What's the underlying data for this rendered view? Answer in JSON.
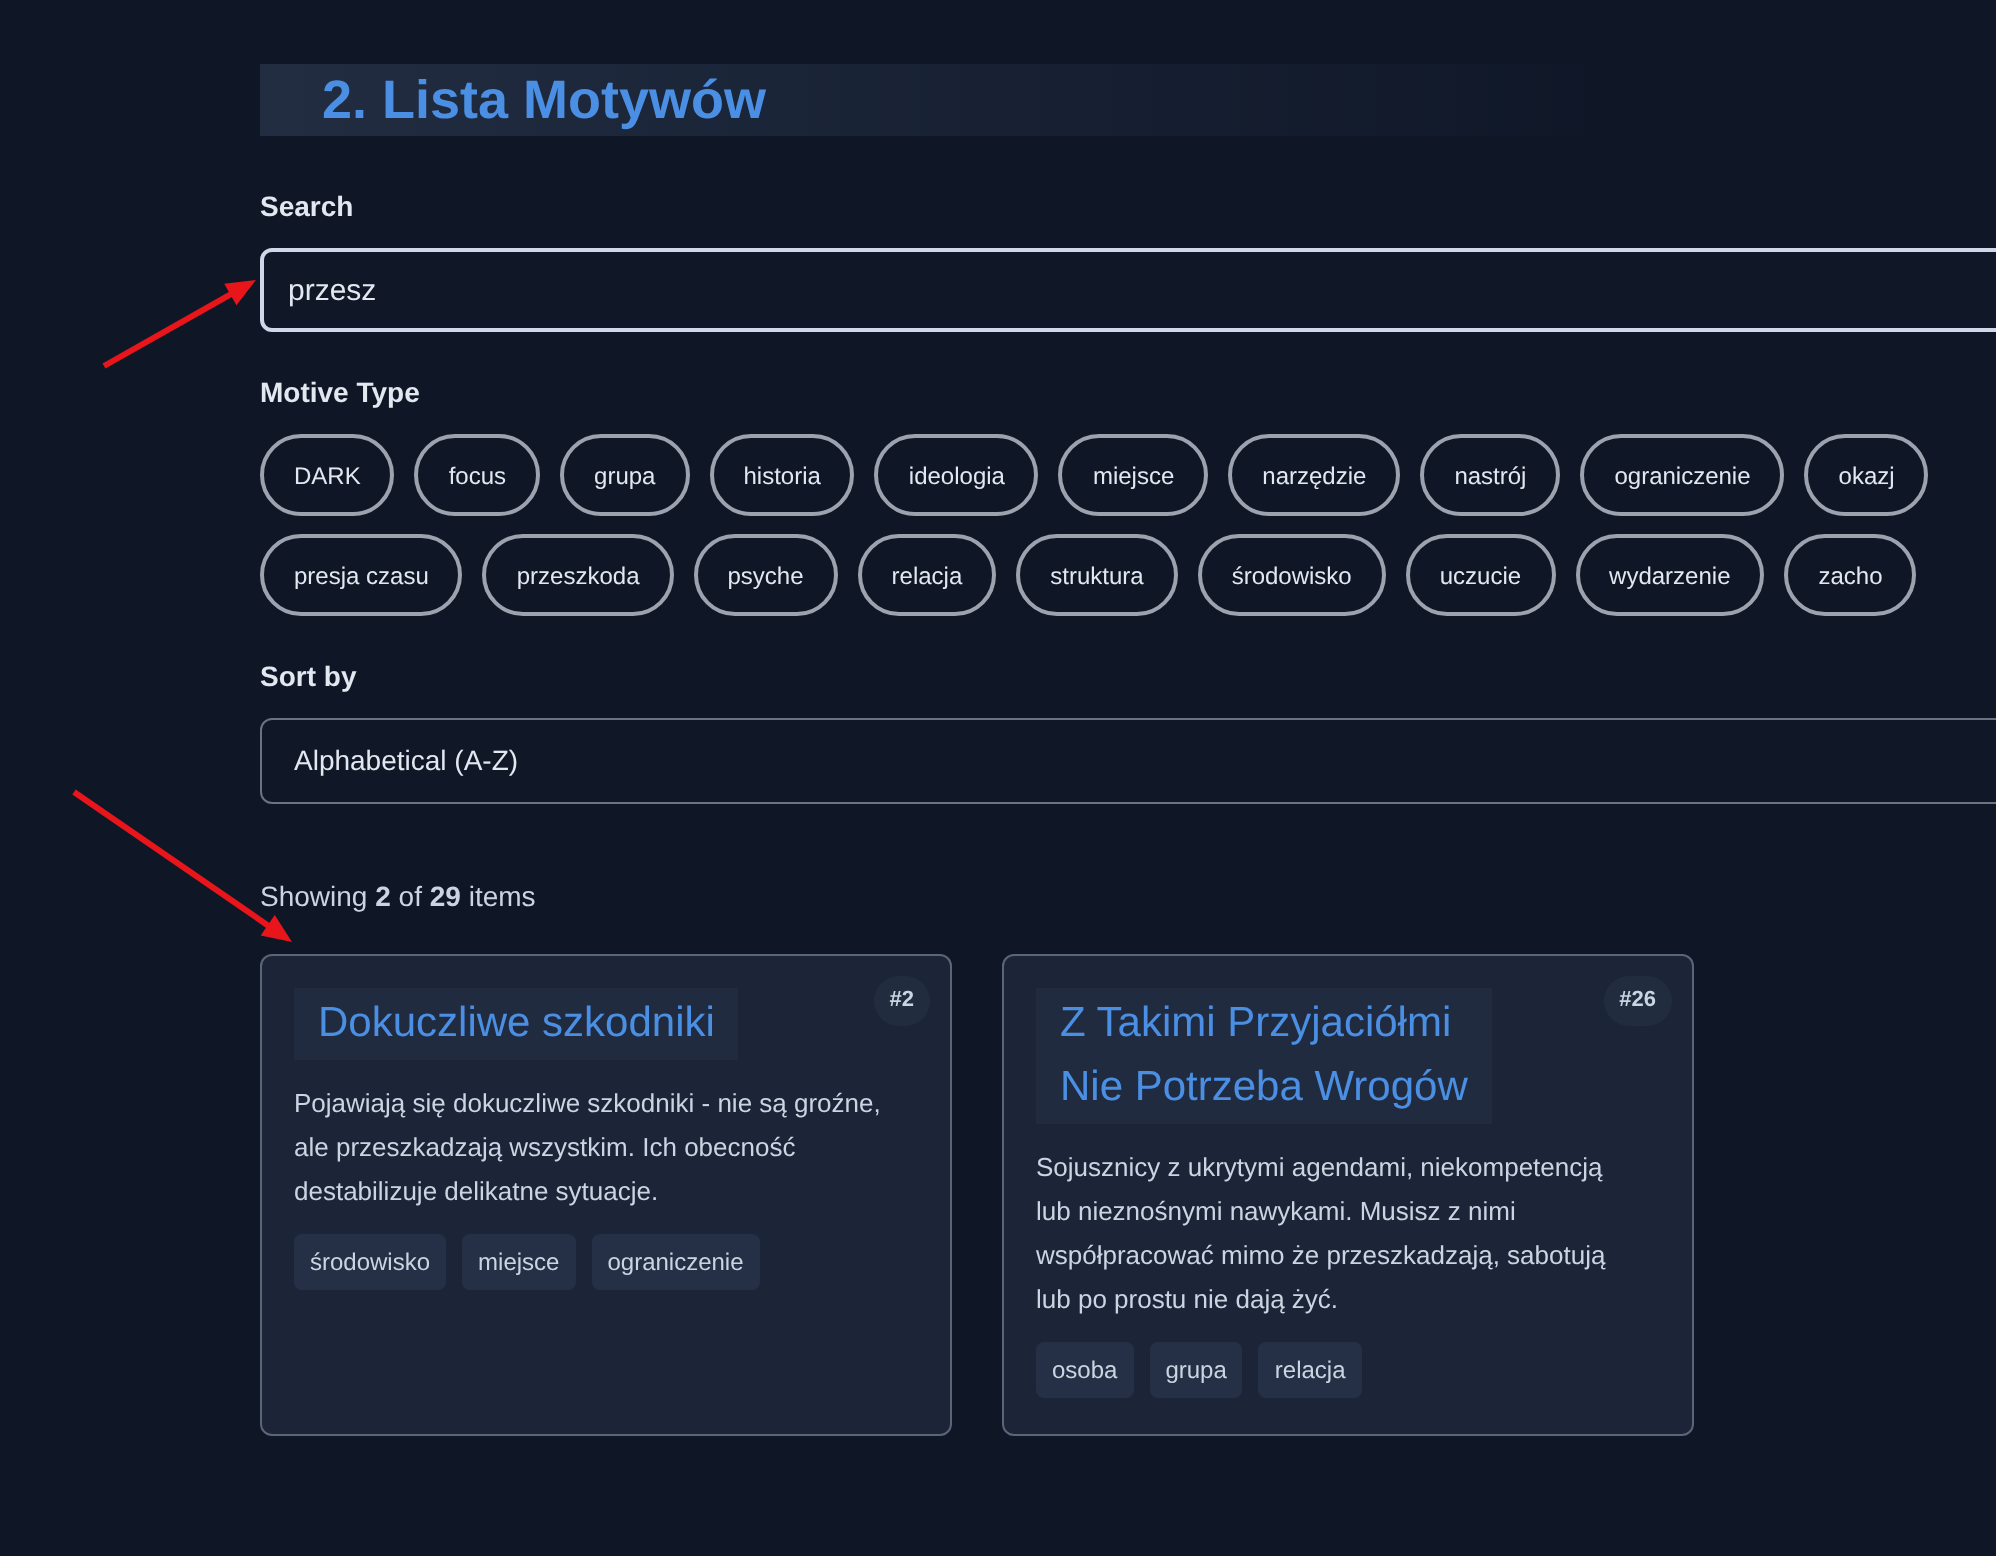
{
  "section_title": "2. Lista Motywów",
  "search": {
    "label": "Search",
    "value": "przesz"
  },
  "motive_type": {
    "label": "Motive Type",
    "chips": [
      {
        "label": "DARK",
        "selected": false
      },
      {
        "label": "focus",
        "selected": false
      },
      {
        "label": "grupa",
        "selected": false
      },
      {
        "label": "historia",
        "selected": false
      },
      {
        "label": "ideologia",
        "selected": false
      },
      {
        "label": "miejsce",
        "selected": false
      },
      {
        "label": "narzędzie",
        "selected": false
      },
      {
        "label": "nastrój",
        "selected": false
      },
      {
        "label": "ograniczenie",
        "selected": false
      },
      {
        "label": "okazj",
        "selected": false
      },
      {
        "label": "presja czasu",
        "selected": false
      },
      {
        "label": "przeszkoda",
        "selected": false
      },
      {
        "label": "psyche",
        "selected": false
      },
      {
        "label": "relacja",
        "selected": false
      },
      {
        "label": "struktura",
        "selected": false
      },
      {
        "label": "środowisko",
        "selected": false
      },
      {
        "label": "uczucie",
        "selected": false
      },
      {
        "label": "wydarzenie",
        "selected": false
      },
      {
        "label": "zacho",
        "selected": false
      }
    ]
  },
  "sort": {
    "label": "Sort by",
    "value": "Alphabetical (A-Z)"
  },
  "results": "Showing **2** of **29** items",
  "cards": [
    {
      "number": "#2",
      "title": [
        "Dokuczliwe szkodniki"
      ],
      "description": "Pojawiają się dokuczliwe szkodniki - nie są groźne, ale przeszkadzają wszystkim. Ich obecność destabilizuje delikatne sytuacje.",
      "tags": [
        "środowisko",
        "miejsce",
        "ograniczenie"
      ]
    },
    {
      "number": "#26",
      "title": [
        "Z Takimi Przyjaciółmi",
        "Nie Potrzeba Wrogów"
      ],
      "description": "Sojusznicy z ukrytymi agendami, niekompetencją lub nieznośnymi nawykami. Musisz z nimi współpracować mimo że przeszkadzają, sabotują lub po prostu nie dają żyć.",
      "tags": [
        "osoba",
        "grupa",
        "relacja"
      ]
    }
  ]
}
